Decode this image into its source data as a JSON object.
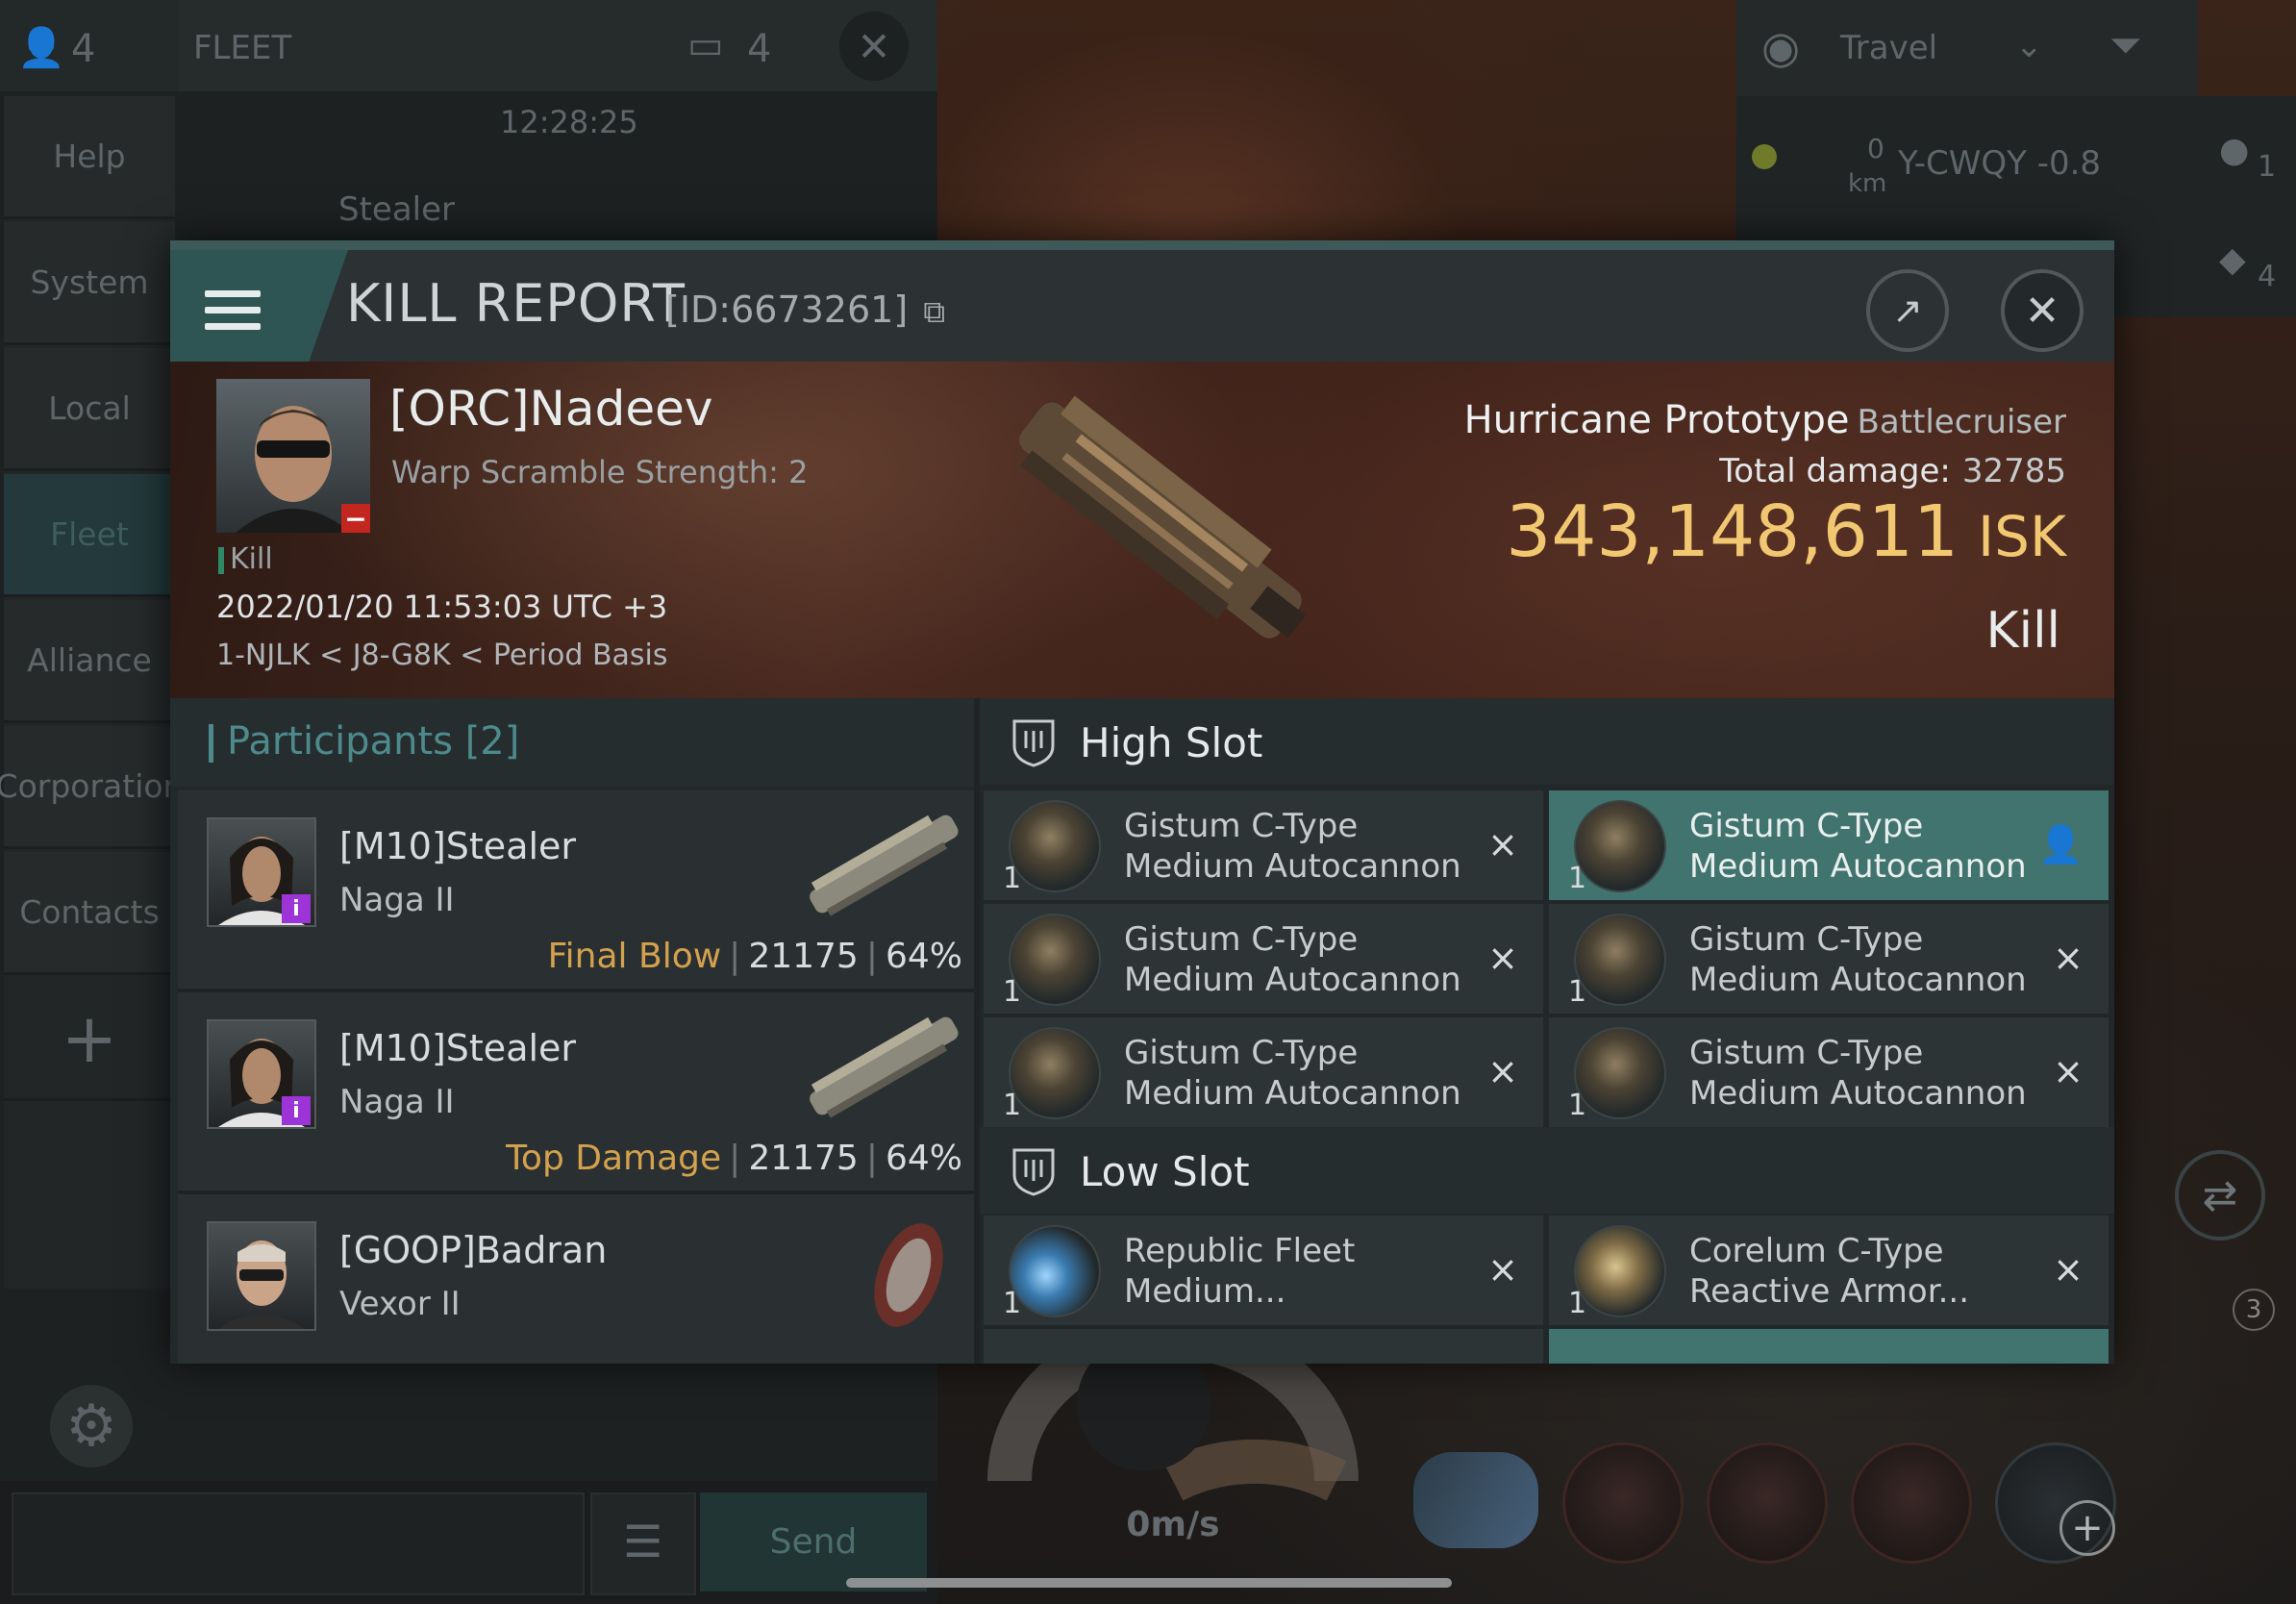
{
  "fleet_header": {
    "member_count": "4",
    "title": "FLEET",
    "squad_count": "4"
  },
  "chat": {
    "time": "12:28:25",
    "first_speaker": "Stealer",
    "send_label": "Send"
  },
  "left_menu": [
    "Help",
    "System",
    "Local",
    "Fleet",
    "Alliance",
    "Corporation",
    "Contacts"
  ],
  "top_right": {
    "mode": "Travel"
  },
  "overview_row": {
    "distance_value": "0",
    "distance_unit": "km",
    "name": "Y-CWQY -0.8"
  },
  "side_counts": [
    "1",
    "4"
  ],
  "hud": {
    "speed": "0m/s",
    "drone_count": "3"
  },
  "kill_report": {
    "title": "KILL REPORT",
    "id_text": "[ID:6673261]",
    "pilot_name": "[ORC]Nadeev",
    "warp_scramble": "Warp Scramble Strength: 2",
    "status_tag": "Kill",
    "datetime": "2022/01/20 11:53:03 UTC +3",
    "location": "1-NJLK < J8-G8K < Period Basis",
    "ship_name": "Hurricane Prototype",
    "ship_class": "Battlecruiser",
    "total_damage_label": "Total damage:",
    "total_damage": "32785",
    "isk_value": "343,148,611",
    "isk_unit": "ISK",
    "outcome": "Kill"
  },
  "participants": {
    "title": "Participants",
    "count": "[2]",
    "rows": [
      {
        "name": "[M10]Stealer",
        "ship": "Naga II",
        "label": "Final Blow",
        "damage": "21175",
        "percent": "64%"
      },
      {
        "name": "[M10]Stealer",
        "ship": "Naga II",
        "label": "Top Damage",
        "damage": "21175",
        "percent": "64%"
      },
      {
        "name": "[GOOP]Badran",
        "ship": "Vexor II"
      }
    ]
  },
  "slots": {
    "high_title": "High Slot",
    "low_title": "Low Slot",
    "high_items": [
      {
        "qty": "1",
        "name": "Gistum C-Type Medium Autocannon",
        "action": "×"
      },
      {
        "qty": "1",
        "name": "Gistum C-Type Medium Autocannon",
        "action": "person-icon"
      },
      {
        "qty": "1",
        "name": "Gistum C-Type Medium Autocannon",
        "action": "×"
      },
      {
        "qty": "1",
        "name": "Gistum C-Type Medium Autocannon",
        "action": "×"
      },
      {
        "qty": "1",
        "name": "Gistum C-Type Medium Autocannon",
        "action": "×"
      },
      {
        "qty": "1",
        "name": "Gistum C-Type Medium Autocannon",
        "action": "×"
      }
    ],
    "low_items": [
      {
        "qty": "1",
        "name": "Republic Fleet Medium...",
        "action": "×"
      },
      {
        "qty": "1",
        "name": "Corelum C-Type Reactive Armor...",
        "action": "×"
      }
    ]
  }
}
